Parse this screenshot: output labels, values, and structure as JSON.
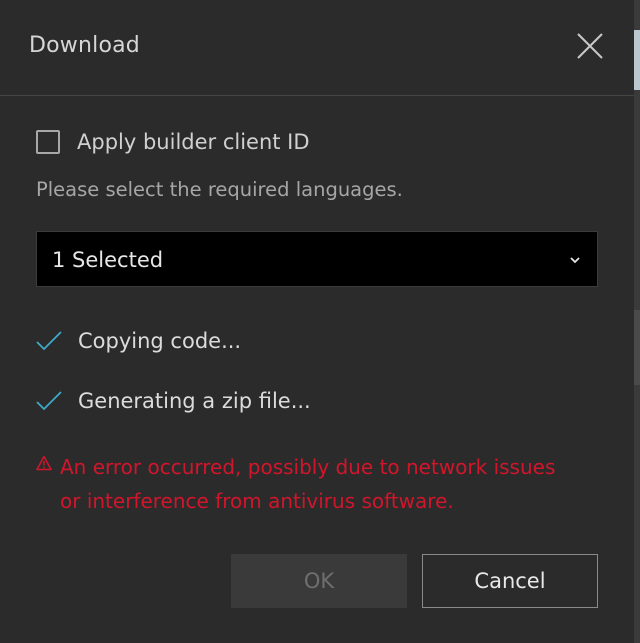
{
  "dialog": {
    "title": "Download",
    "apply_client_id": {
      "label": "Apply builder client ID",
      "checked": false
    },
    "help_text": "Please select the required languages.",
    "language_select": {
      "value": "1 Selected"
    },
    "steps": [
      {
        "label": "Copying code...",
        "status": "done"
      },
      {
        "label": "Generating a zip file...",
        "status": "done"
      }
    ],
    "error": {
      "line1": "An error occurred, possibly due to network issues",
      "line2": "or interference from antivirus software."
    },
    "buttons": {
      "ok_label": "OK",
      "ok_enabled": false,
      "cancel_label": "Cancel"
    }
  },
  "colors": {
    "background": "#2b2b2b",
    "accent_check": "#3fa9c7",
    "error": "#d1162c"
  },
  "icons": {
    "close": "close-icon",
    "chevron": "chevron-down-icon",
    "check": "check-icon",
    "warning": "warning-icon"
  }
}
